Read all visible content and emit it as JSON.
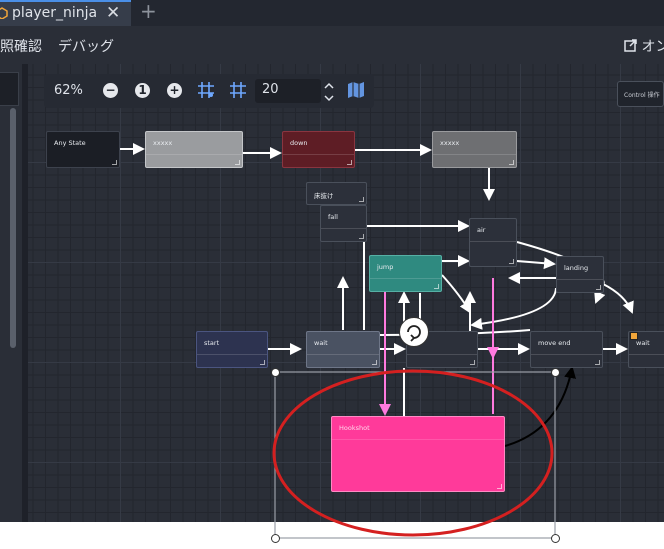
{
  "tab": {
    "title": "player_ninja",
    "close": "✕",
    "add": "+"
  },
  "menu": {
    "item1": "照確認",
    "item2": "デバッグ",
    "external": "オン"
  },
  "toolbar": {
    "zoom": "62%",
    "snap_value": "20"
  },
  "control_button": "Control 操作",
  "nodes": {
    "any_state": "Any State",
    "state1": "xxxxx",
    "down": "down",
    "state2": "xxxxx",
    "small": "床抜け",
    "fall": "fall",
    "air": "air",
    "jump": "jump",
    "landing": "landing",
    "start": "start",
    "wait1": "wait",
    "move_end": "move end",
    "wait2": "wait",
    "hookshot": "Hookshot"
  },
  "colors": {
    "graph_bg": "#2a2e37",
    "node_default": "#2c303a",
    "jump_node": "#2f8a80",
    "hookshot_node": "#ff3a9a",
    "pink_link": "#ff7adf",
    "annotation_red": "#d42020"
  }
}
